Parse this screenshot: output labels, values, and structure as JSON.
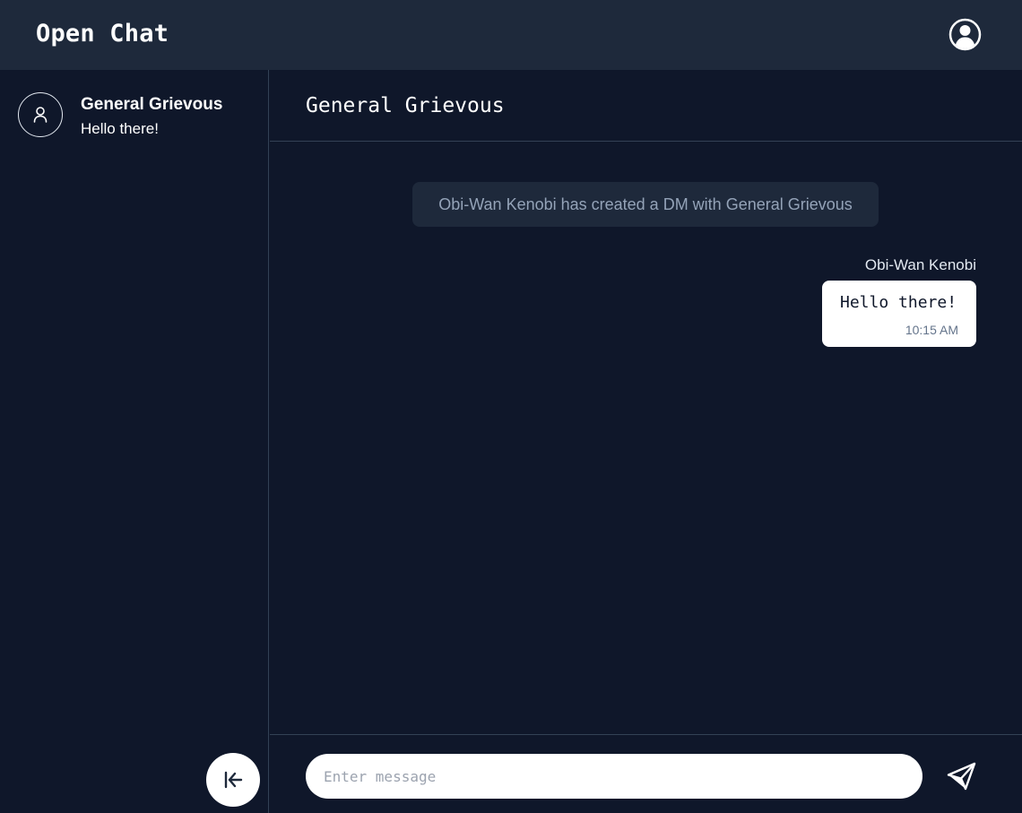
{
  "app": {
    "title": "Open Chat"
  },
  "header": {
    "account_icon": "user-circle-icon"
  },
  "sidebar": {
    "conversations": [
      {
        "name": "General Grievous",
        "preview": "Hello there!",
        "icon": "user-icon"
      }
    ],
    "collapse_icon": "arrow-left-to-line-icon"
  },
  "chat": {
    "title": "General Grievous",
    "system_message": "Obi-Wan Kenobi has created a DM with General Grievous",
    "messages": [
      {
        "sender": "Obi-Wan Kenobi",
        "text": "Hello there!",
        "time": "10:15 AM"
      }
    ],
    "input": {
      "placeholder": "Enter message",
      "value": ""
    },
    "send_icon": "paper-plane-icon"
  },
  "colors": {
    "background": "#0f172a",
    "header_background": "#1e293b",
    "divider": "#334155",
    "system_message_background": "#1e293b",
    "system_message_text": "#94a3b8",
    "bubble_background": "#ffffff"
  }
}
